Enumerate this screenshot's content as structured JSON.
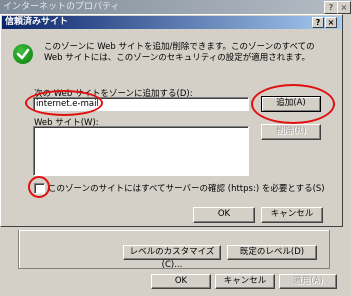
{
  "outer_window": {
    "title": "インターネットのプロパティ",
    "help_btn": "?",
    "close_btn": "×",
    "custom_level_button": "レベルのカスタマイズ(C)...",
    "default_level_button": "既定のレベル(D)",
    "ok_button": "OK",
    "cancel_button": "キャンセル",
    "apply_button": "適用(A)"
  },
  "dialog": {
    "title": "信頼済みサイト",
    "help_btn": "?",
    "close_btn": "×",
    "description": "このゾーンに Web サイトを追加/削除できます。このゾーンのすべての Web サイトには、このゾーンのセキュリティの設定が適用されます。",
    "add_label": "次の Web サイトをゾーンに追加する(D):",
    "add_input_value": "internet.e-mail",
    "add_button": "追加(A)",
    "sites_label": "Web サイト(W):",
    "remove_button": "削除(R)",
    "https_checkbox_label": "このゾーンのサイトにはすべてサーバーの確認 (https:) を必要とする(S)",
    "ok_button": "OK",
    "cancel_button": "キャンセル"
  },
  "annotation_color": "#e01010"
}
